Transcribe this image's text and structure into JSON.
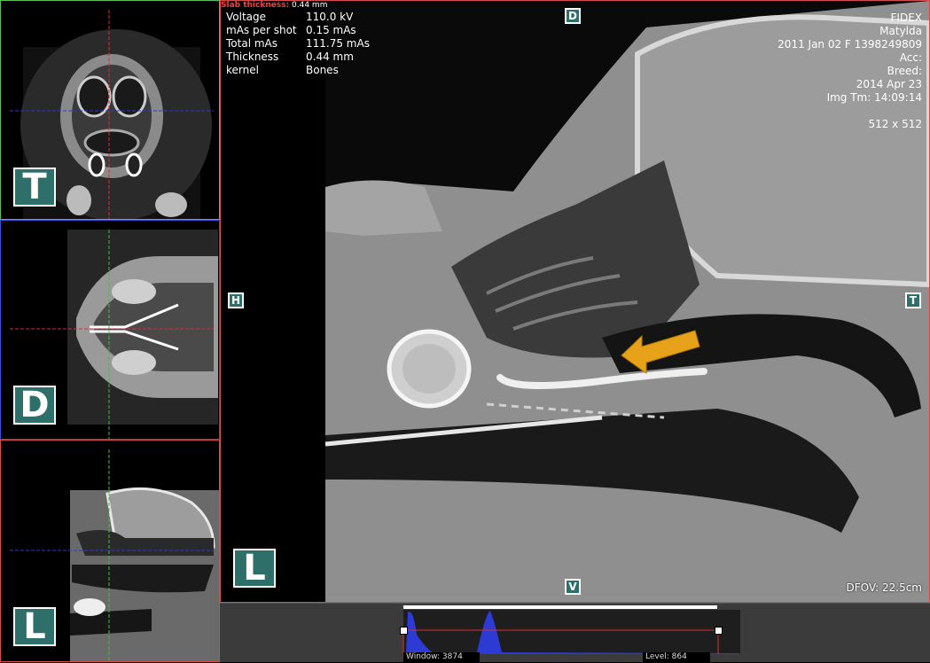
{
  "main_view": {
    "slab_label": "Slab thickness:",
    "slab_value": "0.44 mm",
    "technique": [
      {
        "label": "Voltage",
        "value": "110.0 kV"
      },
      {
        "label": "mAs per shot",
        "value": "0.15 mAs"
      },
      {
        "label": "Total mAs",
        "value": "111.75 mAs"
      },
      {
        "label": "Thickness",
        "value": "0.44 mm"
      },
      {
        "label": "kernel",
        "value": "Bones"
      }
    ],
    "patient": {
      "institution": "FIDEX",
      "name": "Matylda",
      "dob_sex_id": "2011 Jan 02   F   1398249809",
      "acc": "Acc:",
      "breed": "Breed:",
      "study_date": "2014 Apr 23",
      "img_time": "Img Tm: 14:09:14",
      "matrix": "512 x 512"
    },
    "dfov": "DFOV: 22.5cm",
    "orient": {
      "top": "D",
      "bottom": "V",
      "left": "H",
      "right": "T",
      "plane": "L"
    }
  },
  "mini_views": {
    "axial_orient": "T",
    "dorsal_orient": "D",
    "lateral_orient": "L"
  },
  "histogram": {
    "window_label": "Window: 3874",
    "level_label": "Level: 864"
  },
  "colors": {
    "axial_border": "#5bbd5b",
    "dorsal_border": "#3a4fd9",
    "lateral_border": "#d94a4a",
    "annotation_arrow": "#e8a21a"
  }
}
